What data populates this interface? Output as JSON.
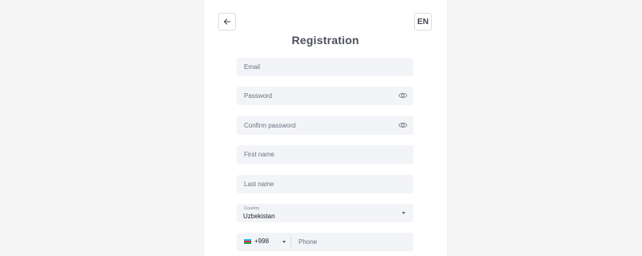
{
  "header": {
    "title": "Registration",
    "language": "EN"
  },
  "form": {
    "email_placeholder": "Email",
    "password_placeholder": "Password",
    "confirm_password_placeholder": "Confirm password",
    "first_name_placeholder": "First name",
    "last_name_placeholder": "Last name",
    "country": {
      "label": "Country",
      "value": "Uzbekistan"
    },
    "phone": {
      "dial_code": "+998",
      "placeholder": "Phone"
    }
  },
  "icons": {
    "back": "arrow-left-icon",
    "eye": "eye-icon",
    "dropdown": "caret-down-icon",
    "flag": "flag-uzbekistan-icon"
  }
}
